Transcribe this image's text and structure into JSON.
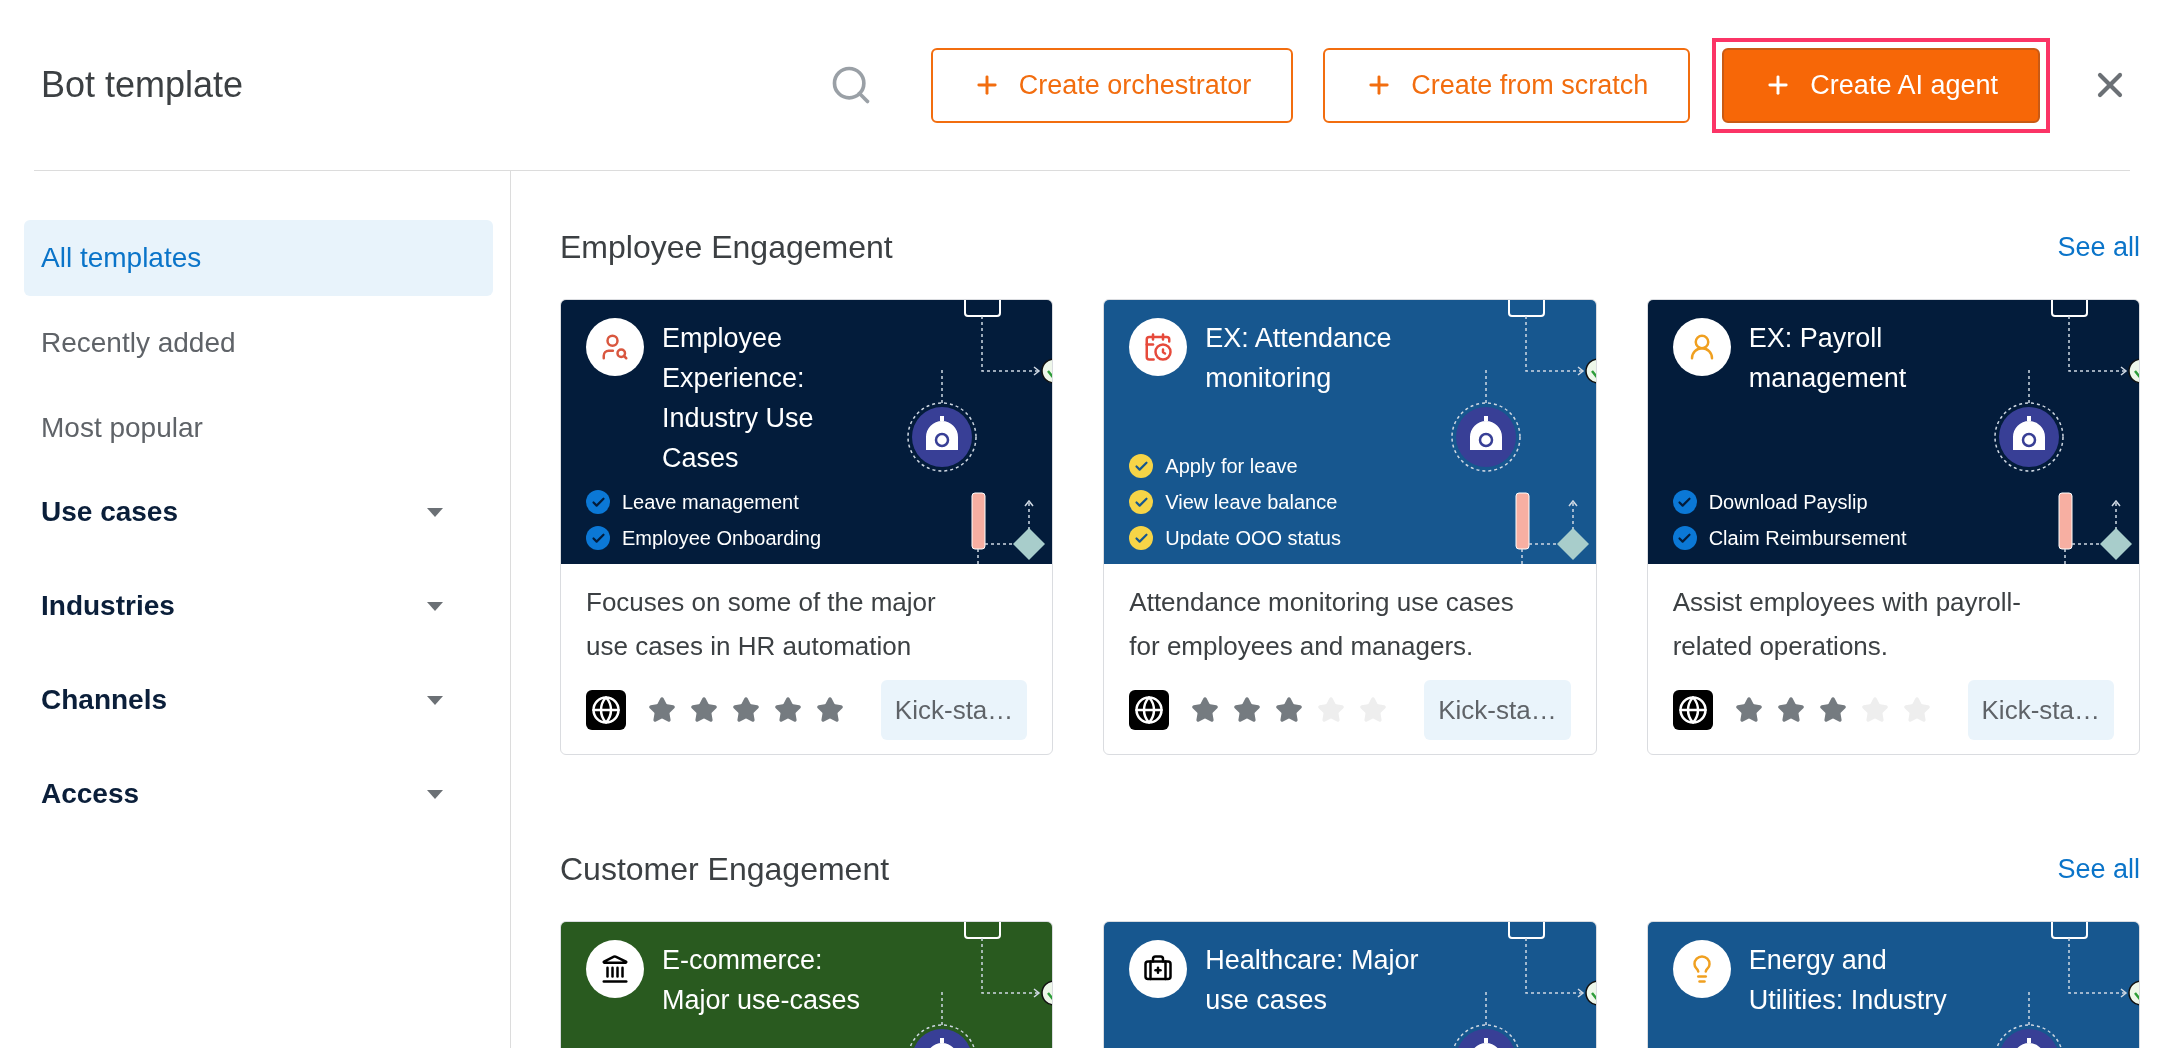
{
  "header": {
    "title": "Bot template",
    "buttons": [
      {
        "label": "Create orchestrator",
        "kind": "outline",
        "highlighted": false
      },
      {
        "label": "Create from scratch",
        "kind": "outline",
        "highlighted": false
      },
      {
        "label": "Create AI agent",
        "kind": "primary",
        "highlighted": true
      }
    ]
  },
  "sidebar": {
    "items": [
      {
        "label": "All templates",
        "kind": "link",
        "selected": true
      },
      {
        "label": "Recently added",
        "kind": "link",
        "selected": false
      },
      {
        "label": "Most popular",
        "kind": "link",
        "selected": false
      },
      {
        "label": "Use cases",
        "kind": "dropdown",
        "selected": false
      },
      {
        "label": "Industries",
        "kind": "dropdown",
        "selected": false
      },
      {
        "label": "Channels",
        "kind": "dropdown",
        "selected": false
      },
      {
        "label": "Access",
        "kind": "dropdown",
        "selected": false
      }
    ]
  },
  "sections": [
    {
      "title": "Employee Engagement",
      "link": "See all",
      "cards": [
        {
          "kind": "navy",
          "title": "Employee Experience: Industry Use Cases",
          "features": [
            "Leave management",
            "Employee Onboarding"
          ],
          "description": "Focuses on some of the major use cases in HR automation",
          "stars": 5,
          "tag": "Kick-sta…"
        },
        {
          "kind": "blue",
          "title": "EX: Attendance monitoring",
          "features": [
            "Apply for leave",
            "View leave balance",
            "Update OOO status"
          ],
          "description": "Attendance monitoring use cases for employees and managers.",
          "stars": 3,
          "tag": "Kick-sta…"
        },
        {
          "kind": "navy",
          "title": "EX: Payroll management",
          "features": [
            "Download Payslip",
            "Claim Reimbursement"
          ],
          "description": "Assist employees with payroll-related operations.",
          "stars": 3,
          "tag": "Kick-sta…"
        }
      ]
    },
    {
      "title": "Customer Engagement",
      "link": "See all",
      "cards": [
        {
          "kind": "green",
          "title": "E-commerce: Major use-cases"
        },
        {
          "kind": "blue",
          "title": "Healthcare: Major use cases"
        },
        {
          "kind": "blue",
          "title": "Energy and Utilities: Industry"
        }
      ]
    }
  ]
}
